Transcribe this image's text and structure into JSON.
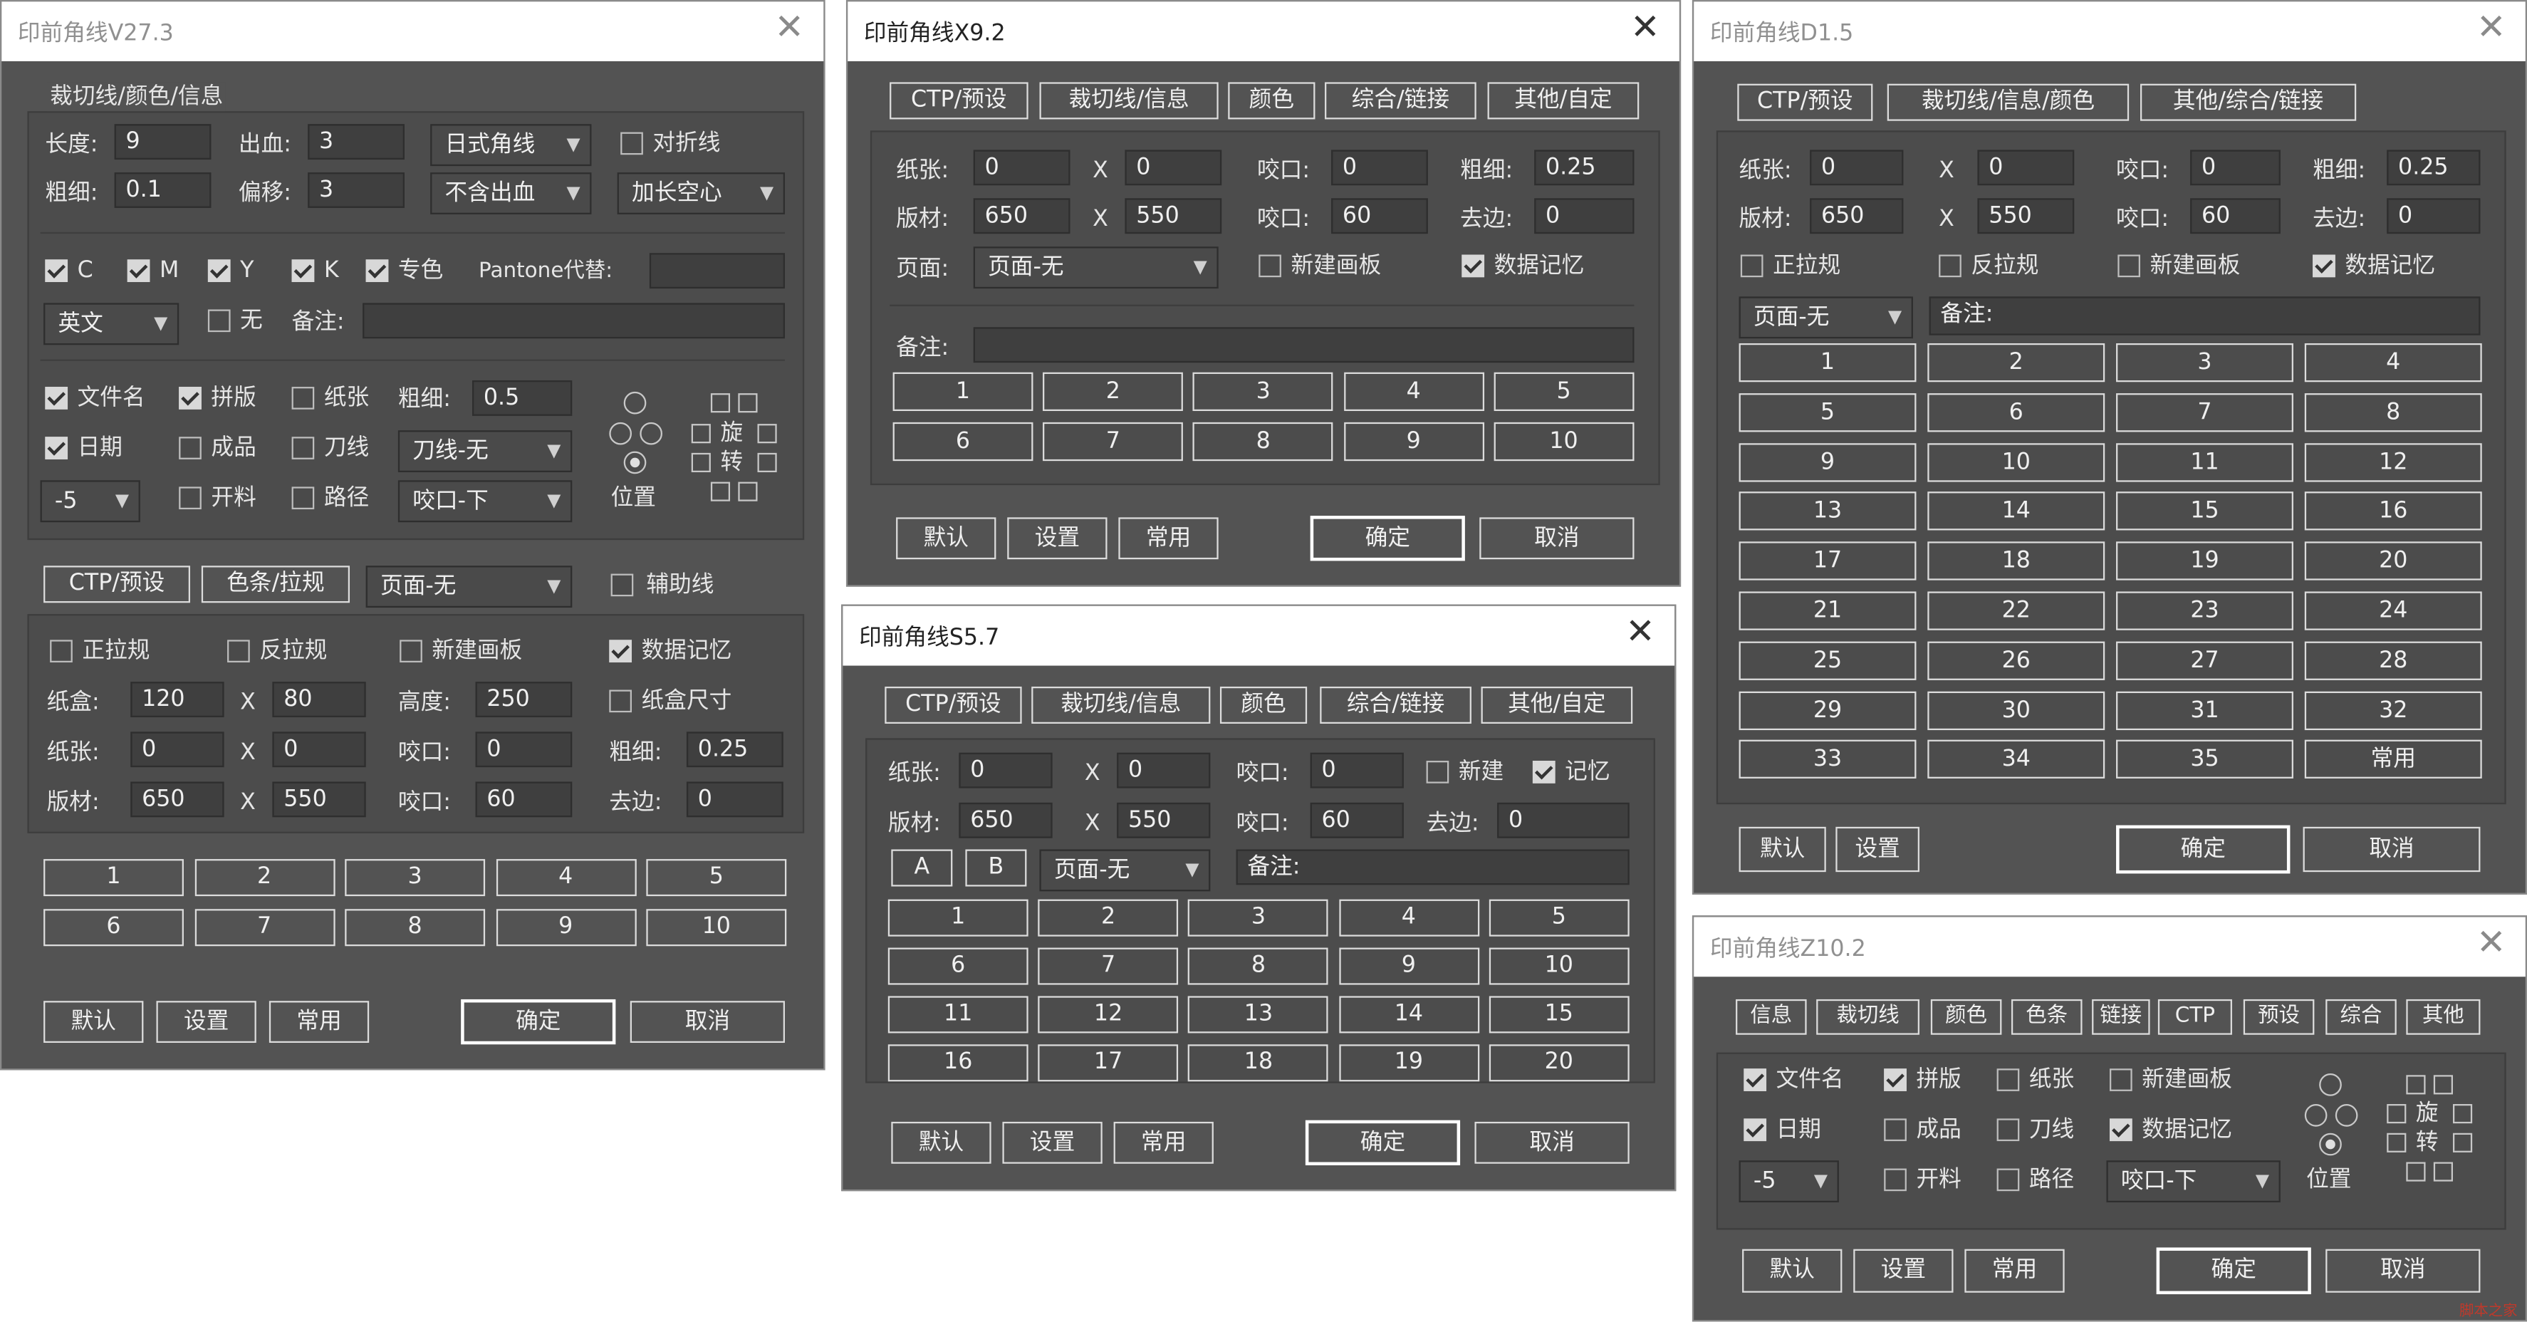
{
  "win1": {
    "title": "印前角线V27.3",
    "group_title": "裁切线/颜色/信息",
    "length_label": "长度:",
    "length_val": "9",
    "bleed_label": "出血:",
    "bleed_val": "3",
    "corner_select": "日式角线",
    "fold_label": "对折线",
    "thick_label": "粗细:",
    "thick_val": "0.1",
    "offset_label": "偏移:",
    "offset_val": "3",
    "bleed_select": "不含出血",
    "center_select": "加长空心",
    "c_label": "C",
    "m_label": "M",
    "y_label": "Y",
    "k_label": "K",
    "spot_label": "专色",
    "pantone_label": "Pantone代替:",
    "lang_select": "英文",
    "none_label": "无",
    "note_label": "备注:",
    "filename_label": "文件名",
    "impose_label": "拼版",
    "paper_label": "纸张",
    "thick2_label": "粗细:",
    "thick2_val": "0.5",
    "date_label": "日期",
    "product_label": "成品",
    "knife_label": "刀线",
    "knife_select": "刀线-无",
    "offset_select": "-5",
    "open_label": "开料",
    "path_label": "路径",
    "bite_select": "咬口-下",
    "position_label": "位置",
    "rotate1": "旋",
    "rotate2": "转",
    "ctp_tab": "CTP/预设",
    "colorbar_tab": "色条/拉规",
    "page_select": "页面-无",
    "aux_label": "辅助线",
    "front_pull": "正拉规",
    "back_pull": "反拉规",
    "new_board": "新建画板",
    "data_mem": "数据记忆",
    "box_label": "纸盒:",
    "box_w": "120",
    "x1": "X",
    "box_h": "80",
    "height_label": "高度:",
    "height_val": "250",
    "box_size": "纸盒尺寸",
    "paper2_label": "纸张:",
    "paper_w": "0",
    "x2": "X",
    "paper_h": "0",
    "bite_label": "咬口:",
    "bite_val": "0",
    "thick3_label": "粗细:",
    "thick3_val": "0.25",
    "plate_label": "版材:",
    "plate_w": "650",
    "x3": "X",
    "plate_h": "550",
    "bite2_label": "咬口:",
    "bite2_val": "60",
    "trim_label": "去边:",
    "trim_val": "0",
    "presets": [
      "1",
      "2",
      "3",
      "4",
      "5",
      "6",
      "7",
      "8",
      "9",
      "10"
    ],
    "default_btn": "默认",
    "settings_btn": "设置",
    "common_btn": "常用",
    "ok_btn": "确定",
    "cancel_btn": "取消"
  },
  "win2": {
    "title": "印前角线X9.2",
    "tabs": [
      "CTP/预设",
      "裁切线/信息",
      "颜色",
      "综合/链接",
      "其他/自定"
    ],
    "paper_label": "纸张:",
    "paper_w": "0",
    "x1": "X",
    "paper_h": "0",
    "bite_label": "咬口:",
    "bite_val": "0",
    "thick_label": "粗细:",
    "thick_val": "0.25",
    "plate_label": "版材:",
    "plate_w": "650",
    "x2": "X",
    "plate_h": "550",
    "bite2_label": "咬口:",
    "bite2_val": "60",
    "trim_label": "去边:",
    "trim_val": "0",
    "page_label": "页面:",
    "page_select": "页面-无",
    "new_board": "新建画板",
    "data_mem": "数据记忆",
    "note_label": "备注:",
    "presets": [
      "1",
      "2",
      "3",
      "4",
      "5",
      "6",
      "7",
      "8",
      "9",
      "10"
    ],
    "default_btn": "默认",
    "settings_btn": "设置",
    "common_btn": "常用",
    "ok_btn": "确定",
    "cancel_btn": "取消"
  },
  "win3": {
    "title": "印前角线S5.7",
    "tabs": [
      "CTP/预设",
      "裁切线/信息",
      "颜色",
      "综合/链接",
      "其他/自定"
    ],
    "paper_label": "纸张:",
    "paper_w": "0",
    "x1": "X",
    "paper_h": "0",
    "bite_label": "咬口:",
    "bite_val": "0",
    "new_label": "新建",
    "mem_label": "记忆",
    "plate_label": "版材:",
    "plate_w": "650",
    "x2": "X",
    "plate_h": "550",
    "bite2_label": "咬口:",
    "bite2_val": "60",
    "trim_label": "去边:",
    "trim_val": "0",
    "a_btn": "A",
    "b_btn": "B",
    "page_select": "页面-无",
    "note_label": "备注:",
    "presets": [
      "1",
      "2",
      "3",
      "4",
      "5",
      "6",
      "7",
      "8",
      "9",
      "10",
      "11",
      "12",
      "13",
      "14",
      "15",
      "16",
      "17",
      "18",
      "19",
      "20"
    ],
    "default_btn": "默认",
    "settings_btn": "设置",
    "common_btn": "常用",
    "ok_btn": "确定",
    "cancel_btn": "取消"
  },
  "win4": {
    "title": "印前角线D1.5",
    "tabs": [
      "CTP/预设",
      "裁切线/信息/颜色",
      "其他/综合/链接"
    ],
    "paper_label": "纸张:",
    "paper_w": "0",
    "x1": "X",
    "paper_h": "0",
    "bite_label": "咬口:",
    "bite_val": "0",
    "thick_label": "粗细:",
    "thick_val": "0.25",
    "plate_label": "版材:",
    "plate_w": "650",
    "x2": "X",
    "plate_h": "550",
    "bite2_label": "咬口:",
    "bite2_val": "60",
    "trim_label": "去边:",
    "trim_val": "0",
    "front_pull": "正拉规",
    "back_pull": "反拉规",
    "new_board": "新建画板",
    "data_mem": "数据记忆",
    "page_select": "页面-无",
    "note_label": "备注:",
    "presets": [
      "1",
      "2",
      "3",
      "4",
      "5",
      "6",
      "7",
      "8",
      "9",
      "10",
      "11",
      "12",
      "13",
      "14",
      "15",
      "16",
      "17",
      "18",
      "19",
      "20",
      "21",
      "22",
      "23",
      "24",
      "25",
      "26",
      "27",
      "28",
      "29",
      "30",
      "31",
      "32",
      "33",
      "34",
      "35",
      "常用"
    ],
    "default_btn": "默认",
    "settings_btn": "设置",
    "ok_btn": "确定",
    "cancel_btn": "取消"
  },
  "win5": {
    "title": "印前角线Z10.2",
    "tabs": [
      "信息",
      "裁切线",
      "颜色",
      "色条",
      "链接",
      "CTP",
      "预设",
      "综合",
      "其他"
    ],
    "filename_label": "文件名",
    "impose_label": "拼版",
    "paper_label": "纸张",
    "new_board": "新建画板",
    "date_label": "日期",
    "product_label": "成品",
    "knife_label": "刀线",
    "data_mem": "数据记忆",
    "offset_select": "-5",
    "open_label": "开料",
    "path_label": "路径",
    "bite_select": "咬口-下",
    "position_label": "位置",
    "rotate1": "旋",
    "rotate2": "转",
    "default_btn": "默认",
    "settings_btn": "设置",
    "common_btn": "常用",
    "ok_btn": "确定",
    "cancel_btn": "取消"
  },
  "watermark": "脚本之家"
}
